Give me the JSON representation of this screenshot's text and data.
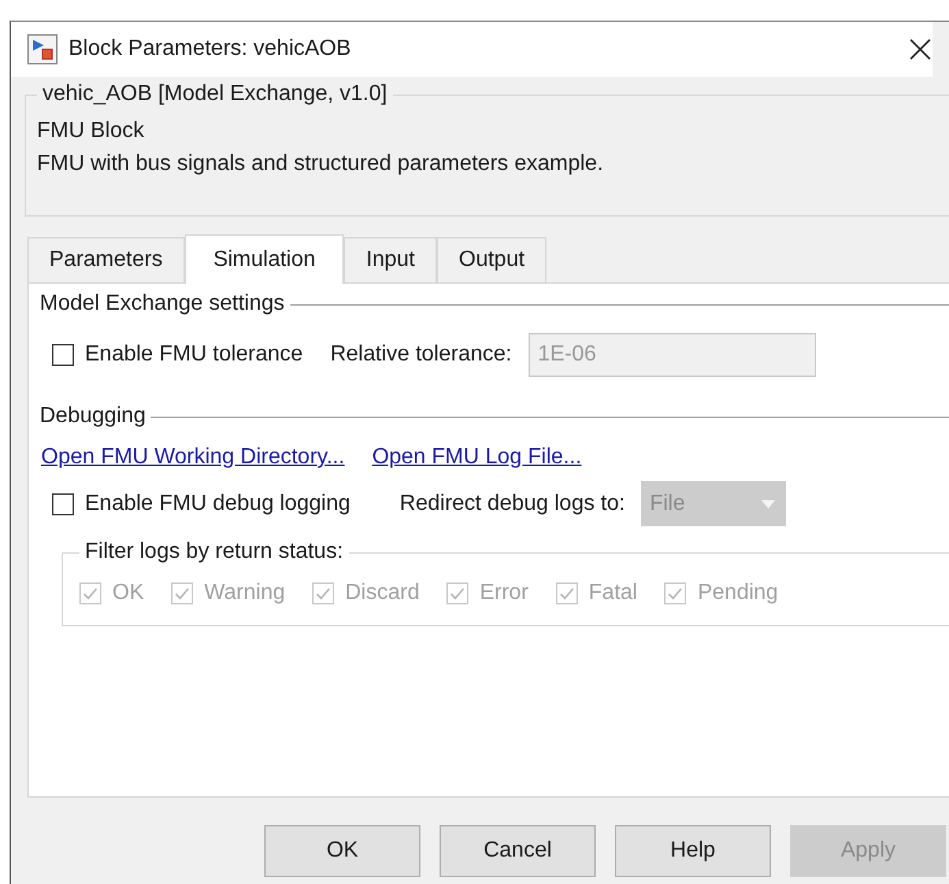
{
  "window": {
    "title": "Block Parameters: vehicAOB"
  },
  "block_info": {
    "title": "vehic_AOB [Model Exchange, v1.0]",
    "lines": [
      "FMU Block",
      "FMU with bus signals and structured parameters example."
    ]
  },
  "tabs": [
    {
      "label": "Parameters",
      "selected": false
    },
    {
      "label": "Simulation",
      "selected": true
    },
    {
      "label": "Input",
      "selected": false
    },
    {
      "label": "Output",
      "selected": false
    }
  ],
  "model_exchange": {
    "title": "Model Exchange settings",
    "tolerance_checkbox": {
      "label": "Enable FMU tolerance",
      "checked": false
    },
    "relative_tolerance": {
      "label": "Relative tolerance:",
      "value": "1E-06",
      "disabled": true
    }
  },
  "debugging": {
    "title": "Debugging",
    "links": [
      "Open FMU Working Directory...",
      "Open FMU Log File..."
    ],
    "debug_checkbox": {
      "label": "Enable FMU debug logging",
      "checked": false
    },
    "redirect": {
      "label": "Redirect debug logs to:",
      "value": "File",
      "disabled": true
    },
    "filter": {
      "title": "Filter logs by return status:",
      "options": [
        {
          "label": "OK",
          "checked": true,
          "disabled": true
        },
        {
          "label": "Warning",
          "checked": true,
          "disabled": true
        },
        {
          "label": "Discard",
          "checked": true,
          "disabled": true
        },
        {
          "label": "Error",
          "checked": true,
          "disabled": true
        },
        {
          "label": "Fatal",
          "checked": true,
          "disabled": true
        },
        {
          "label": "Pending",
          "checked": true,
          "disabled": true
        }
      ]
    }
  },
  "buttons": [
    {
      "label": "OK",
      "disabled": false
    },
    {
      "label": "Cancel",
      "disabled": false
    },
    {
      "label": "Help",
      "disabled": false
    },
    {
      "label": "Apply",
      "disabled": true
    }
  ]
}
